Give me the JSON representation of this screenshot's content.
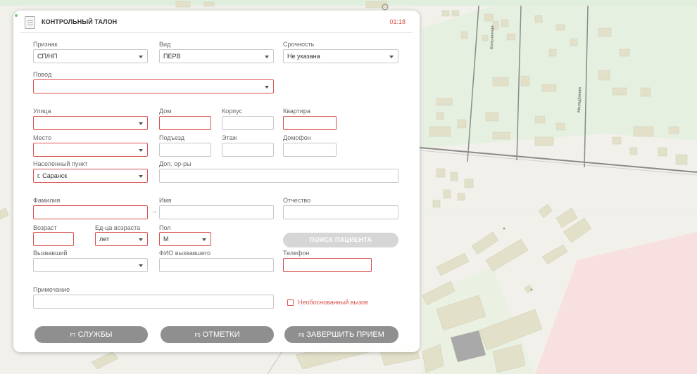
{
  "header": {
    "title": "КОНТРОЛЬНЫЙ ТАЛОН",
    "timer": "01:18"
  },
  "form": {
    "priznak": {
      "label": "Признак",
      "value": "СП/НП"
    },
    "vid": {
      "label": "Вид",
      "value": "ПЕРВ"
    },
    "srochnost": {
      "label": "Срочность",
      "value": "Не указана"
    },
    "povod": {
      "label": "Повод",
      "value": ""
    },
    "ulica": {
      "label": "Улица",
      "value": ""
    },
    "dom": {
      "label": "Дом",
      "value": ""
    },
    "korpus": {
      "label": "Корпус",
      "value": ""
    },
    "kvartira": {
      "label": "Квартира",
      "value": ""
    },
    "mesto": {
      "label": "Место",
      "value": ""
    },
    "podezd": {
      "label": "Подъезд",
      "value": ""
    },
    "etazh": {
      "label": "Этаж",
      "value": ""
    },
    "domofon": {
      "label": "Домофон",
      "value": ""
    },
    "punkt": {
      "label": "Населенный пункт",
      "value": "г. Саранск"
    },
    "dop": {
      "label": "Доп. ор-ры",
      "value": ""
    },
    "familiya": {
      "label": "Фамилия",
      "value": ""
    },
    "imya": {
      "label": "Имя",
      "value": ""
    },
    "otchestvo": {
      "label": "Отчество",
      "value": ""
    },
    "vozrast": {
      "label": "Возраст",
      "value": ""
    },
    "ed_vozrasta": {
      "label": "Ед-ца возраста",
      "value": "лет"
    },
    "pol": {
      "label": "Пол",
      "value": "М"
    },
    "vyzvavshiy": {
      "label": "Вызвавший",
      "value": ""
    },
    "fio_vyzvavshego": {
      "label": "ФИО вызвавшего",
      "value": ""
    },
    "telefon": {
      "label": "Телефон",
      "value": ""
    },
    "primechanie": {
      "label": "Примечание",
      "value": ""
    },
    "neobosnovanny": {
      "label": "Необоснованный вызов",
      "checked": false
    },
    "poisk_label": "ПОИСК ПАЦИЕНТА",
    "separator_arrow": "→"
  },
  "buttons": {
    "services": {
      "key": "F7",
      "label": "СЛУЖБЫ"
    },
    "marks": {
      "key": "F5",
      "label": "ОТМЕТКИ"
    },
    "finish": {
      "key": "F8",
      "label": "ЗАВЕРШИТЬ ПРИЕМ"
    }
  },
  "map": {
    "street_label_1": "Больничная",
    "street_label_2": "Молодёжная"
  },
  "colors": {
    "required_border": "#d9534f",
    "button_gray": "#8f8f8f",
    "timer": "#d9534f"
  }
}
